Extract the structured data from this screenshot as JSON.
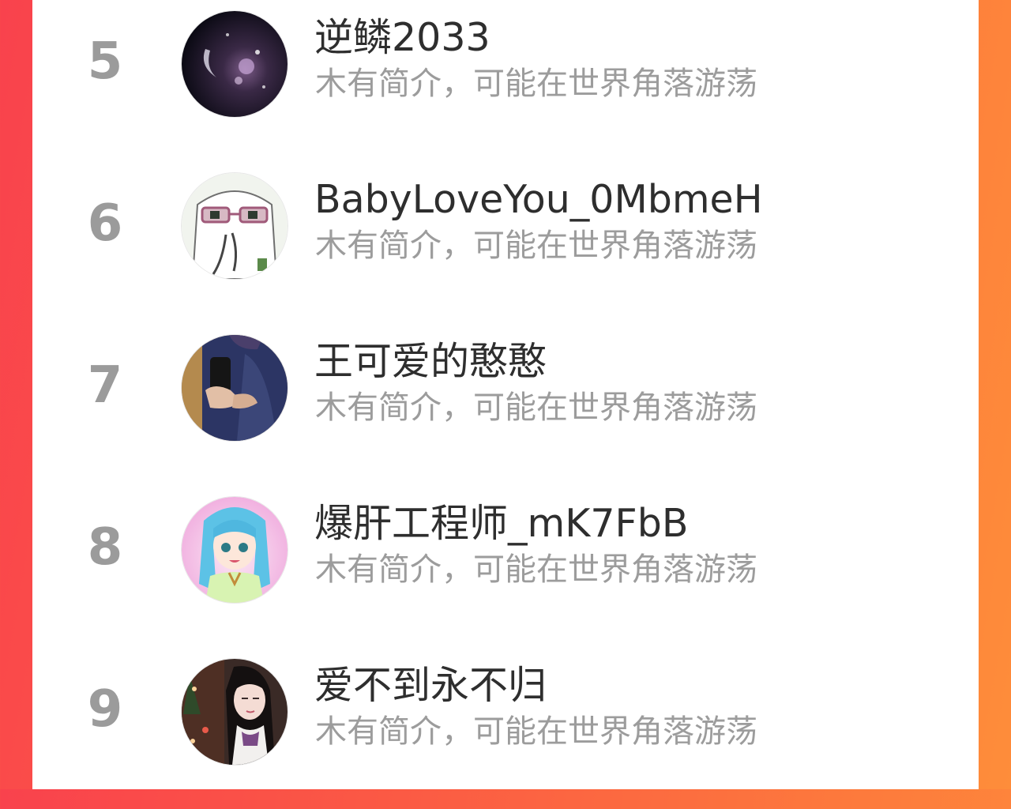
{
  "colors": {
    "background_left": "#f9424d",
    "background_right": "#fe8d3a",
    "card": "#ffffff",
    "rank_text": "#9b9b9b",
    "name_text": "#2e2e2e",
    "bio_text": "#9c9c9c"
  },
  "ranking_list": [
    {
      "rank": "5",
      "name": "逆鳞2033",
      "bio": "木有简介，可能在世界角落游荡",
      "avatar": "avatar-night-sky"
    },
    {
      "rank": "6",
      "name": "BabyLoveYou_0MbmeH",
      "bio": "木有简介，可能在世界角落游荡",
      "avatar": "avatar-cartoon-face"
    },
    {
      "rank": "7",
      "name": "王可爱的憨憨",
      "bio": "木有简介，可能在世界角落游荡",
      "avatar": "avatar-mirror-selfie"
    },
    {
      "rank": "8",
      "name": "爆肝工程师_mK7FbB",
      "bio": "木有简介，可能在世界角落游荡",
      "avatar": "avatar-anime-girl"
    },
    {
      "rank": "9",
      "name": "爱不到永不归",
      "bio": "木有简介，可能在世界角落游荡",
      "avatar": "avatar-portrait-girl"
    }
  ]
}
